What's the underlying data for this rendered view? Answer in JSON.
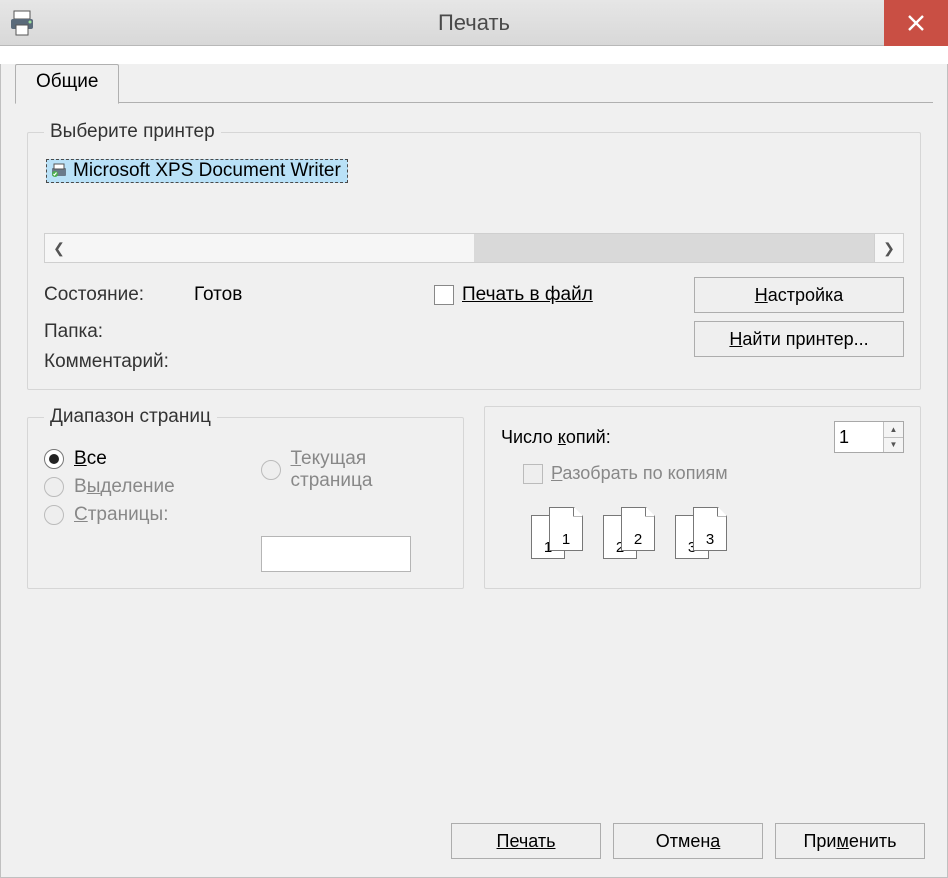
{
  "window": {
    "title": "Печать"
  },
  "tab": {
    "label": "Общие"
  },
  "printerGroup": {
    "title": "Выберите принтер",
    "selected": "Microsoft XPS Document Writer"
  },
  "status": {
    "state_label": "Состояние:",
    "state_value": "Готов",
    "folder_label": "Папка:",
    "folder_value": "",
    "comment_label": "Комментарий:",
    "comment_value": "",
    "print_to_file": "Печать в файл",
    "settings_btn": "Настройка",
    "find_printer_btn": "Найти принтер..."
  },
  "range": {
    "title": "Диапазон страниц",
    "all": "Все",
    "selection": "Выделение",
    "current": "Текущая страница",
    "pages": "Страницы:",
    "pages_value": ""
  },
  "copies": {
    "label": "Число копий:",
    "value": "1",
    "collate": "Разобрать по копиям",
    "seq": [
      "1",
      "1",
      "2",
      "2",
      "3",
      "3"
    ]
  },
  "buttons": {
    "print": "Печать",
    "cancel": "Отмена",
    "apply": "Применить"
  },
  "accel": {
    "n": "Н",
    "a": "а"
  }
}
